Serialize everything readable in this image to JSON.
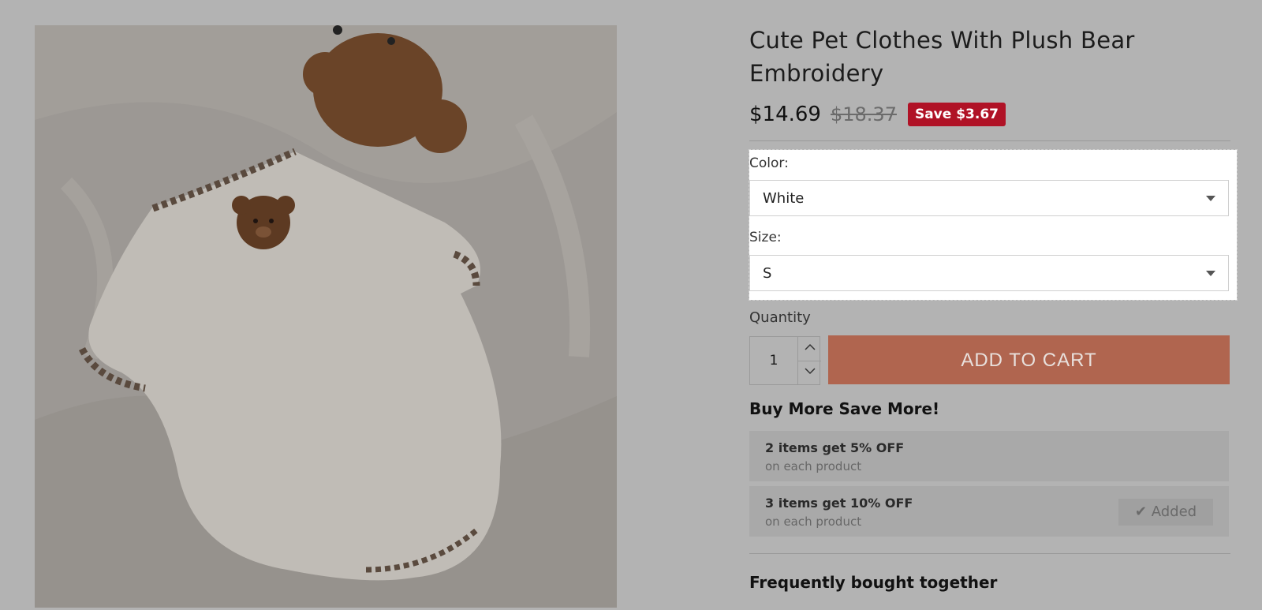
{
  "product": {
    "title": "Cute Pet Clothes With Plush Bear Embroidery",
    "price": "$14.69",
    "compare_price": "$18.37",
    "save_badge": "Save $3.67"
  },
  "options": {
    "color_label": "Color:",
    "color_value": "White",
    "size_label": "Size:",
    "size_value": "S"
  },
  "quantity": {
    "label": "Quantity",
    "value": "1",
    "up_icon": "chevron-up-icon",
    "down_icon": "chevron-down-icon"
  },
  "cart": {
    "button_label": "ADD TO CART"
  },
  "buy_more": {
    "title": "Buy More Save More!",
    "tiers": [
      {
        "headline": "2 items get 5% OFF",
        "sub": "on each product"
      },
      {
        "headline": "3 items get 10% OFF",
        "sub": "on each product",
        "button": "Added",
        "button_icon": "check-icon"
      }
    ]
  },
  "fbt": {
    "title": "Frequently bought together"
  },
  "colors": {
    "accent": "#b0654f",
    "badge": "#b01226"
  }
}
